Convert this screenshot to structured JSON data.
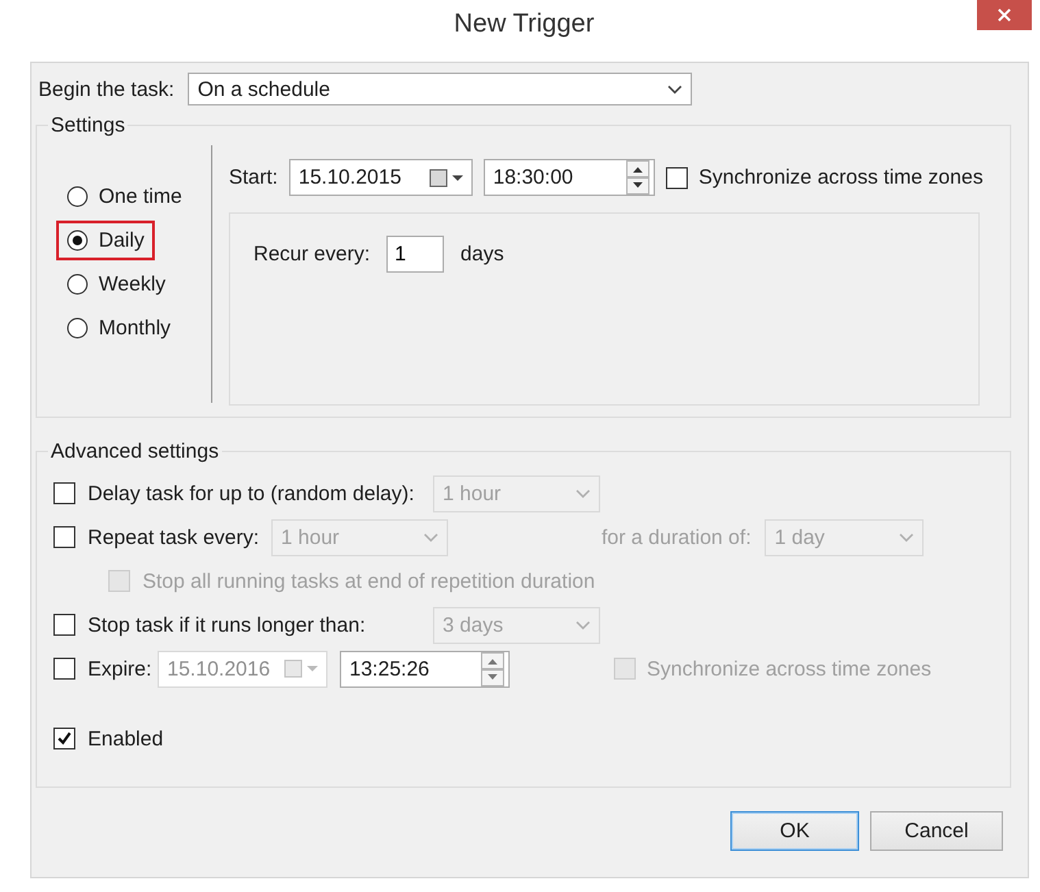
{
  "window": {
    "title": "New Trigger"
  },
  "begin_task": {
    "label": "Begin the task:",
    "value": "On a schedule"
  },
  "settings": {
    "legend": "Settings",
    "schedules": [
      {
        "label": "One time",
        "selected": false,
        "highlighted": false
      },
      {
        "label": "Daily",
        "selected": true,
        "highlighted": true
      },
      {
        "label": "Weekly",
        "selected": false,
        "highlighted": false
      },
      {
        "label": "Monthly",
        "selected": false,
        "highlighted": false
      }
    ],
    "start": {
      "label": "Start:",
      "date": "15.10.2015",
      "time": "18:30:00"
    },
    "sync": {
      "label": "Synchronize across time zones",
      "checked": false
    },
    "recur": {
      "label": "Recur every:",
      "value": "1",
      "unit": "days"
    }
  },
  "advanced": {
    "legend": "Advanced settings",
    "delay": {
      "label": "Delay task for up to (random delay):",
      "checked": false,
      "value": "1 hour",
      "disabled": true
    },
    "repeat": {
      "label": "Repeat task every:",
      "checked": false,
      "value": "1 hour",
      "disabled": true,
      "duration_label": "for a duration of:",
      "duration_value": "1 day"
    },
    "stop_all": {
      "label": "Stop all running tasks at end of repetition duration",
      "checked": false,
      "disabled": true
    },
    "stop_task": {
      "label": "Stop task if it runs longer than:",
      "checked": false,
      "value": "3 days",
      "disabled": true
    },
    "expire": {
      "label": "Expire:",
      "checked": false,
      "date": "15.10.2016",
      "time": "13:25:26",
      "disabled": true,
      "sync_label": "Synchronize across time zones",
      "sync_checked": false
    },
    "enabled": {
      "label": "Enabled",
      "checked": true
    }
  },
  "buttons": [
    {
      "label": "OK",
      "default": true
    },
    {
      "label": "Cancel",
      "default": false
    }
  ]
}
